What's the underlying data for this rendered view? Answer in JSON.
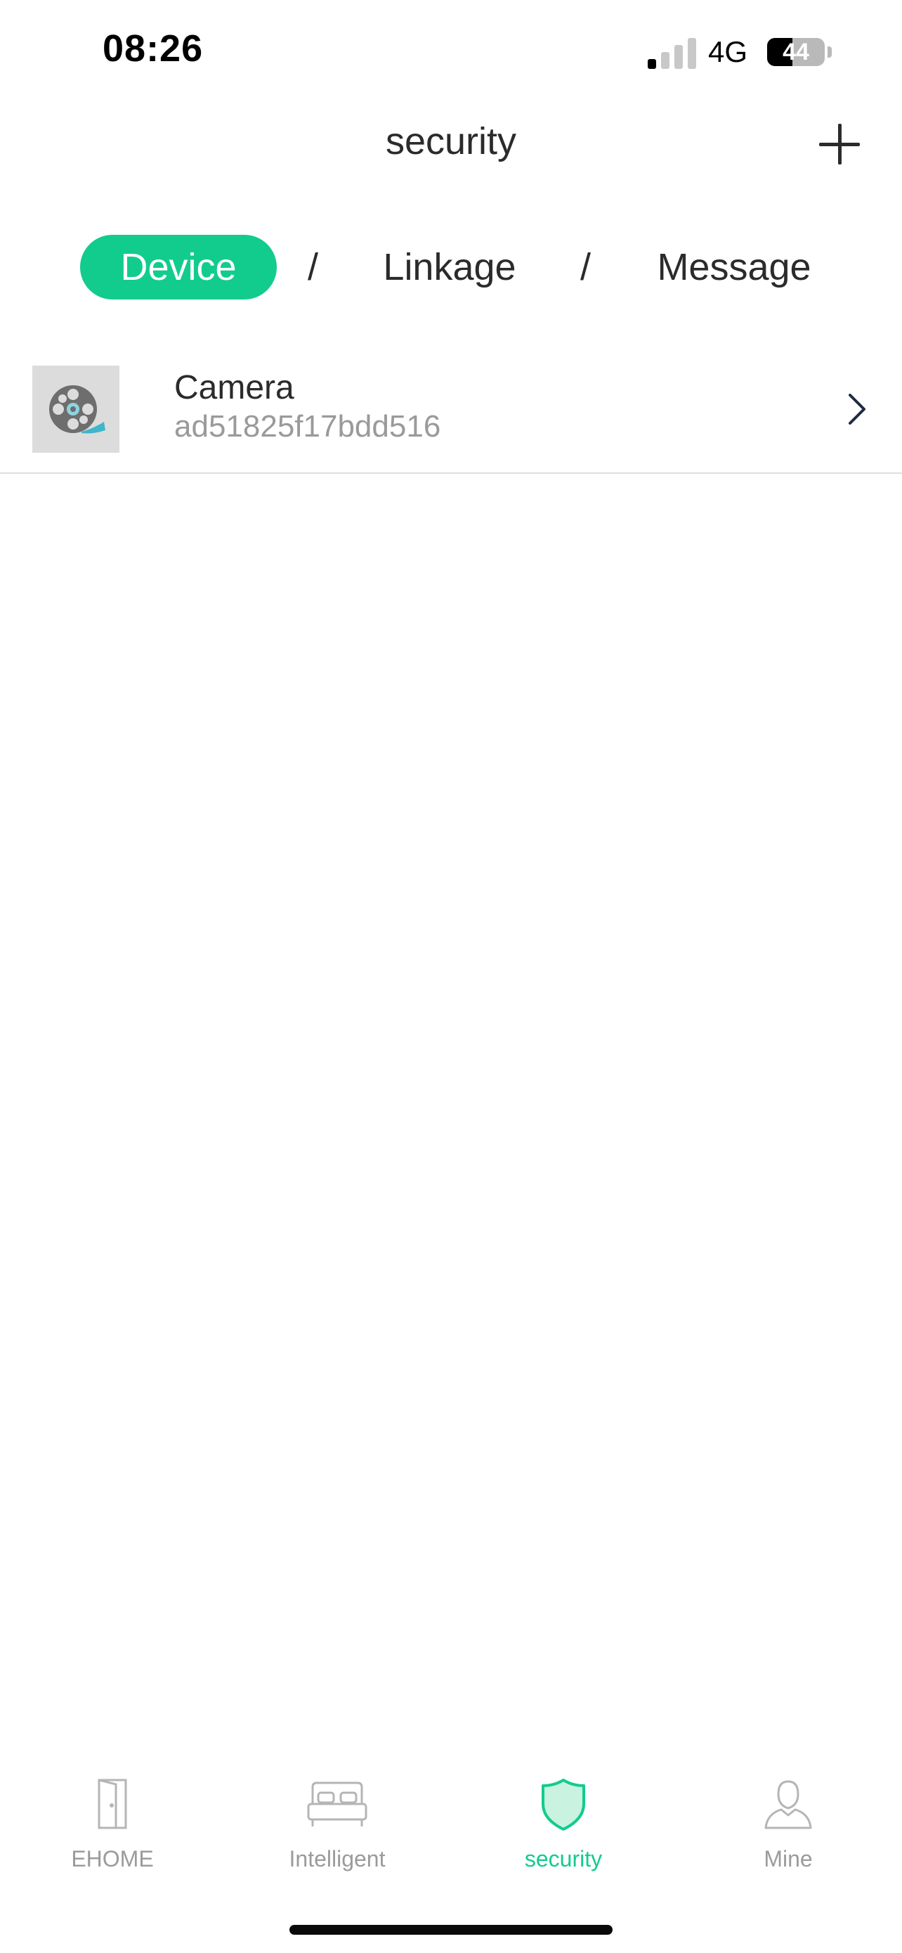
{
  "status_bar": {
    "time": "08:26",
    "network": "4G",
    "battery": "44",
    "battery_level_percent": 44,
    "signal_bars_on": 1,
    "signal_bars_total": 4
  },
  "header": {
    "title": "security",
    "add_icon": "plus-icon"
  },
  "segments": {
    "items": [
      {
        "label": "Device",
        "active": true
      },
      {
        "label": "Linkage",
        "active": false
      },
      {
        "label": "Message",
        "active": false
      }
    ],
    "separator": "/"
  },
  "devices": [
    {
      "name": "Camera",
      "id": "ad51825f17bdd516",
      "icon": "film-reel-icon"
    }
  ],
  "tabbar": {
    "items": [
      {
        "label": "EHOME",
        "icon": "door-icon",
        "active": false
      },
      {
        "label": "Intelligent",
        "icon": "bed-icon",
        "active": false
      },
      {
        "label": "security",
        "icon": "shield-icon",
        "active": true
      },
      {
        "label": "Mine",
        "icon": "person-icon",
        "active": false
      }
    ]
  },
  "colors": {
    "accent": "#12cc8d",
    "inactive": "#9b9b9b",
    "text": "#2b2b2b"
  }
}
